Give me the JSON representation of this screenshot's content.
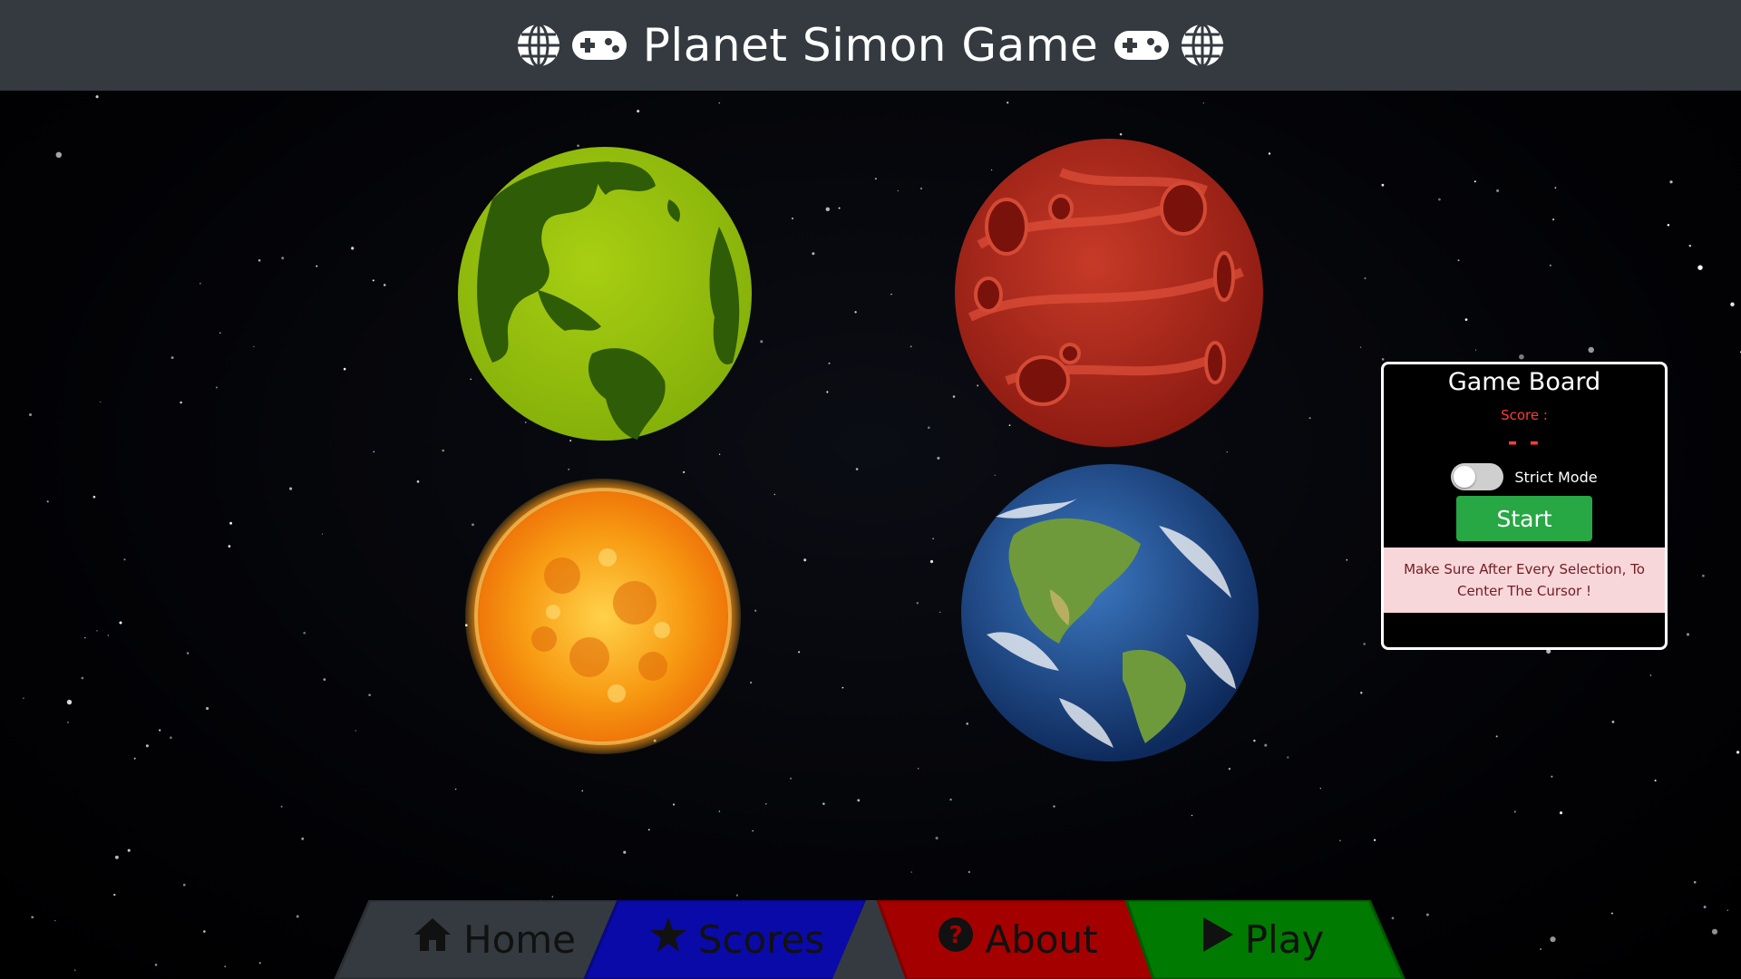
{
  "header": {
    "title": "Planet Simon Game",
    "left_icons": [
      "globe-icon",
      "gamepad-icon"
    ],
    "right_icons": [
      "gamepad-icon",
      "globe-icon"
    ]
  },
  "planets": [
    {
      "name": "green-planet",
      "color": "#98c00f"
    },
    {
      "name": "red-planet",
      "color": "#b5281e"
    },
    {
      "name": "sun",
      "color": "#f59a10"
    },
    {
      "name": "earth",
      "color": "#1e4f9a"
    }
  ],
  "board": {
    "title": "Game Board",
    "score_label": "Score :",
    "score_value": "- -",
    "strict_label": "Strict Mode",
    "strict_on": false,
    "start_label": "Start",
    "notice": "Make Sure After Every Selection, To Center The Cursor !"
  },
  "nav": {
    "home": "Home",
    "scores": "Scores",
    "about": "About",
    "play": "Play"
  },
  "colors": {
    "header_bg": "#343a40",
    "home": "#343a40",
    "scores": "#0a0aa8",
    "about": "#a50000",
    "play": "#007a00",
    "start_button": "#28a745",
    "score_text": "#ff3b3b"
  }
}
